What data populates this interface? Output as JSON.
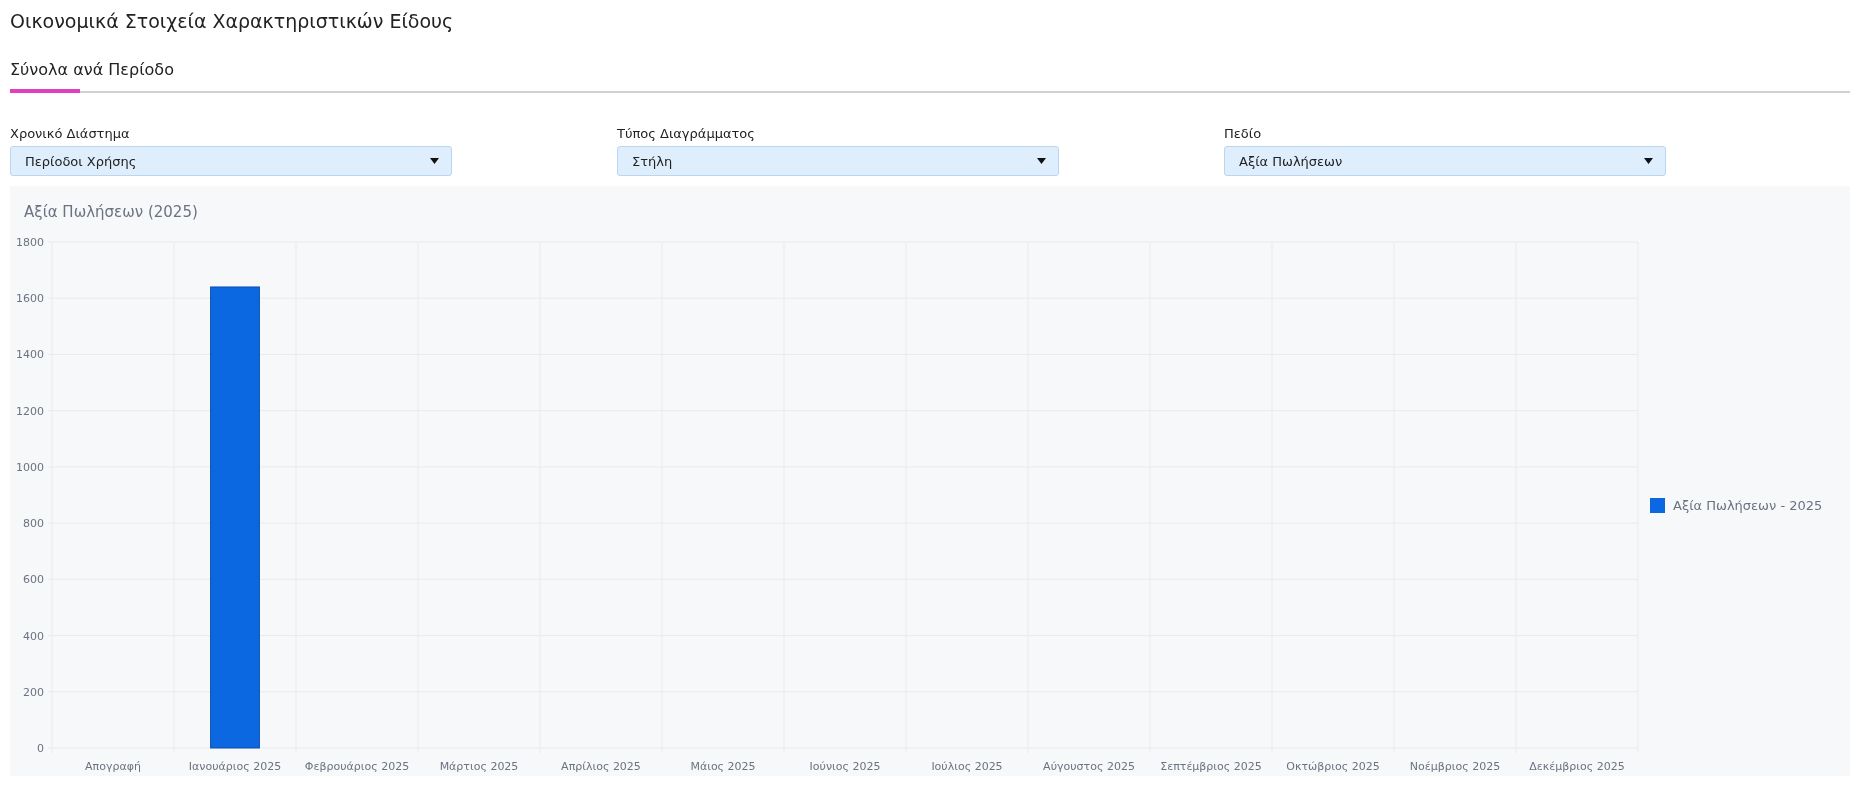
{
  "page_title": "Οικονομικά Στοιχεία Χαρακτηριστικών Είδους",
  "tabs": [
    {
      "label": "Σύνολα ανά Περίοδο",
      "selected": true
    }
  ],
  "filters": [
    {
      "label": "Χρονικό Διάστημα",
      "value": "Περίοδοι Χρήσης"
    },
    {
      "label": "Τύπος Διαγράμματος",
      "value": "Στήλη"
    },
    {
      "label": "Πεδίο",
      "value": "Αξία Πωλήσεων"
    }
  ],
  "chart": {
    "chart_data": {
      "type": "bar",
      "title": "Αξία Πωλήσεων (2025)",
      "categories": [
        "Απογραφή",
        "Ιανουάριος 2025",
        "Φεβρουάριος 2025",
        "Μάρτιος 2025",
        "Απρίλιος 2025",
        "Μάιος 2025",
        "Ιούνιος 2025",
        "Ιούλιος 2025",
        "Αύγουστος 2025",
        "Σεπτέμβριος 2025",
        "Οκτώβριος 2025",
        "Νοέμβριος 2025",
        "Δεκέμβριος 2025"
      ],
      "series": [
        {
          "name": "Αξία Πωλήσεων - 2025",
          "color": "#0b68e0",
          "values": [
            0,
            1640,
            0,
            0,
            0,
            0,
            0,
            0,
            0,
            0,
            0,
            0,
            0
          ]
        }
      ],
      "grid": true,
      "ylim": [
        0,
        1800
      ],
      "yticks": [
        0,
        200,
        400,
        600,
        800,
        1000,
        1200,
        1400,
        1600,
        1800
      ]
    }
  }
}
